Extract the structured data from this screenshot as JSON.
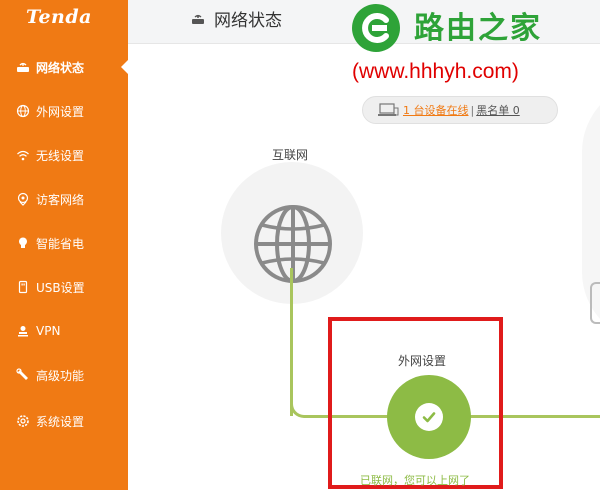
{
  "brand": {
    "logo": "Tenda"
  },
  "sidebar": {
    "items": [
      {
        "label": "网络状态",
        "icon": "router-icon",
        "active": true
      },
      {
        "label": "外网设置",
        "icon": "globe-icon"
      },
      {
        "label": "无线设置",
        "icon": "wifi-icon"
      },
      {
        "label": "访客网络",
        "icon": "guest-icon"
      },
      {
        "label": "智能省电",
        "icon": "bulb-icon"
      },
      {
        "label": "USB设置",
        "icon": "usb-icon"
      },
      {
        "label": "VPN",
        "icon": "vpn-icon"
      },
      {
        "label": "高级功能",
        "icon": "wrench-icon"
      },
      {
        "label": "系统设置",
        "icon": "gear-icon"
      }
    ]
  },
  "header": {
    "title": "网络状态"
  },
  "watermark": {
    "name": "路由之家",
    "url": "(www.hhhyh.com)"
  },
  "devices": {
    "online_text": "1 台设备在线",
    "blacklist_text": "黑名单 0"
  },
  "topology": {
    "internet_label": "互联网",
    "wan_label": "外网设置",
    "wan_status": "已联网，您可以上网了"
  },
  "colors": {
    "sidebar": "#f07a14",
    "link": "#f07a14",
    "connected": "#8dbb45",
    "line": "#a9c55d",
    "highlight": "#e01b1b",
    "watermark_green": "#2ea338",
    "watermark_red": "#e00000"
  }
}
